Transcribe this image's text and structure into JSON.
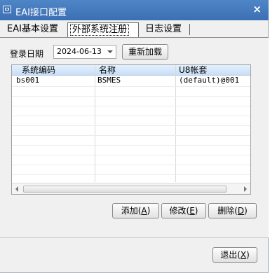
{
  "window": {
    "title": "EAI接口配置",
    "close_label": "×"
  },
  "tabs": [
    {
      "label": "EAI基本设置"
    },
    {
      "label": "外部系统注册"
    },
    {
      "label": "日志设置"
    }
  ],
  "toolbar": {
    "date_label": "登录日期",
    "date_value": "2024-06-13",
    "reload_label": "重新加载"
  },
  "table": {
    "columns": [
      "系统编码",
      "名称",
      "U8帐套"
    ],
    "rows": [
      [
        "bs001",
        "BSMES",
        "(default)@001"
      ]
    ]
  },
  "actions": {
    "add_label": "添加(",
    "add_key": "A",
    "edit_label": "修改(",
    "edit_key": "E",
    "delete_label": "删除(",
    "delete_key": "D",
    "close_paren": ")"
  },
  "footer": {
    "exit_label": "退出(",
    "exit_key": "X"
  }
}
